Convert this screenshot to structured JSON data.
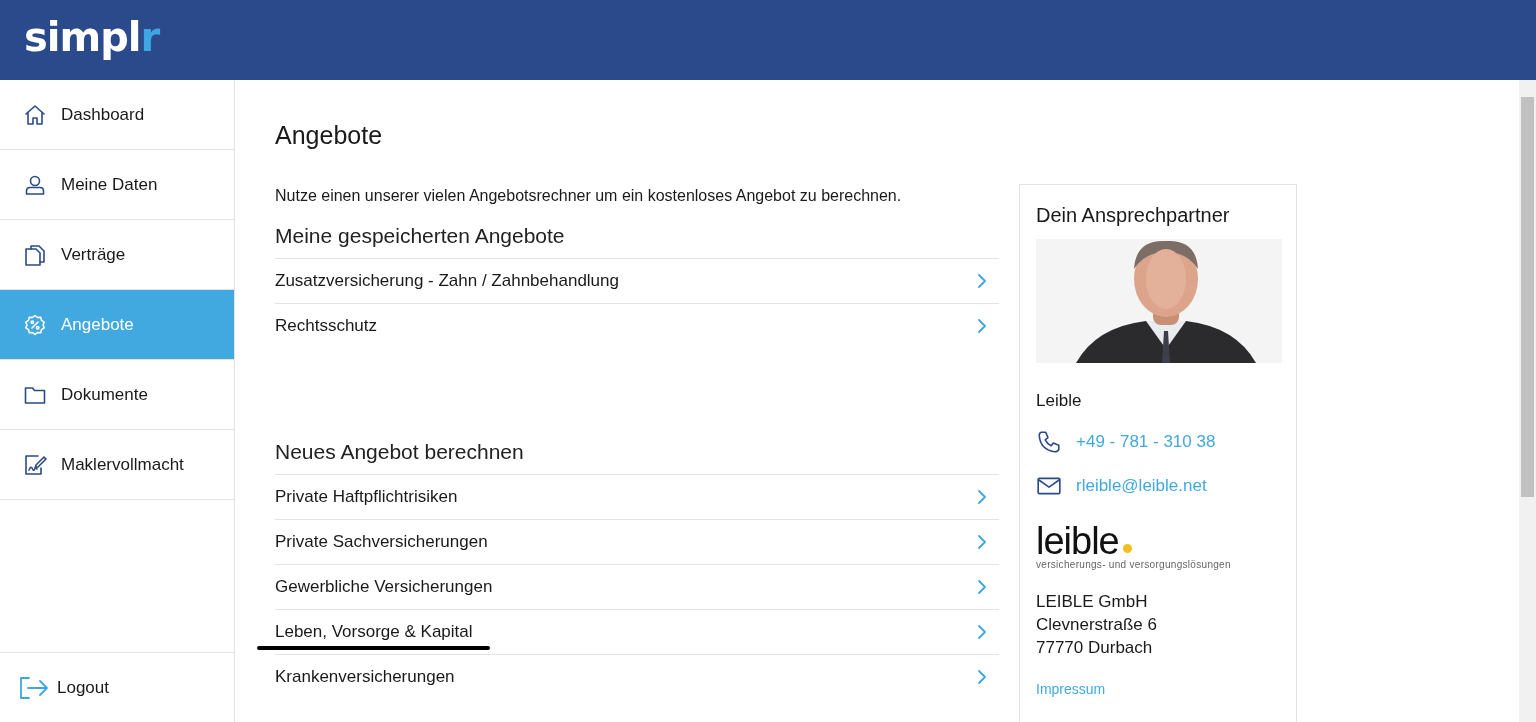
{
  "header": {
    "logo_main": "simpl",
    "logo_accent": "r"
  },
  "sidebar": {
    "items": [
      {
        "label": "Dashboard",
        "selected": false
      },
      {
        "label": "Meine Daten",
        "selected": false
      },
      {
        "label": "Verträge",
        "selected": false
      },
      {
        "label": "Angebote",
        "selected": true
      },
      {
        "label": "Dokumente",
        "selected": false
      },
      {
        "label": "Maklervollmacht",
        "selected": false
      }
    ],
    "logout": "Logout"
  },
  "page": {
    "title": "Angebote",
    "intro": "Nutze einen unserer vielen Angebotsrechner um ein kostenloses Angebot zu berechnen.",
    "sections": [
      {
        "heading": "Meine gespeicherten Angebote",
        "items": [
          {
            "label": "Zusatzversicherung - Zahn / Zahnbehandlung",
            "underlined": false
          },
          {
            "label": "Rechtsschutz",
            "underlined": false
          }
        ]
      },
      {
        "heading": "Neues Angebot berechnen",
        "items": [
          {
            "label": "Private Haftpflichtrisiken",
            "underlined": false
          },
          {
            "label": "Private Sachversicherungen",
            "underlined": false
          },
          {
            "label": "Gewerbliche Versicherungen",
            "underlined": false
          },
          {
            "label": "Leben, Vorsorge & Kapital",
            "underlined": true
          },
          {
            "label": "Krankenversicherungen",
            "underlined": false
          }
        ]
      }
    ]
  },
  "contact": {
    "title": "Dein Ansprechpartner",
    "name": "Leible",
    "phone": "+49 - 781 - 310 38",
    "email": "rleible@leible.net",
    "company_logo": {
      "wordmark": "leible",
      "tagline": "versicherungs- und versorgungslösungen"
    },
    "address": [
      "LEIBLE GmbH",
      "Clevnerstraße 6",
      "77770 Durbach"
    ],
    "imprint_link": "Impressum"
  }
}
